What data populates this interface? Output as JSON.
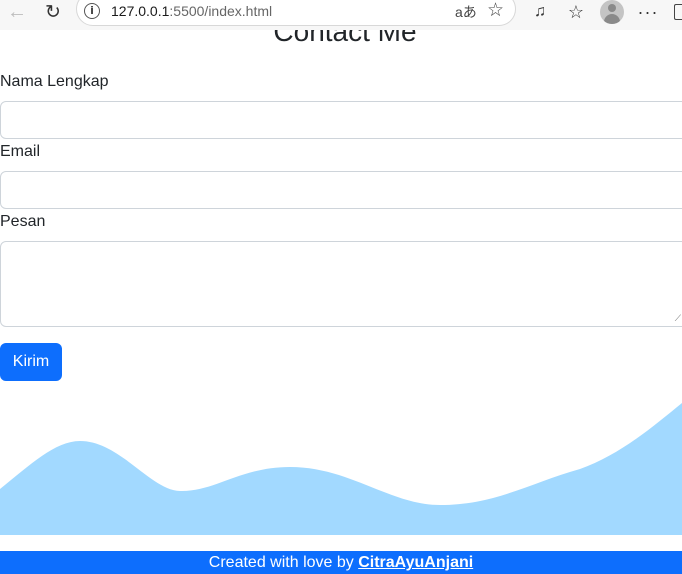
{
  "browser": {
    "url_host": "127.0.0.1",
    "url_path": ":5500/index.html",
    "read_aloud_glyph": "aあ"
  },
  "page": {
    "title": "Contact Me",
    "form": {
      "name_label": "Nama Lengkap",
      "name_value": "",
      "email_label": "Email",
      "email_value": "",
      "message_label": "Pesan",
      "message_value": "",
      "submit_label": "Kirim"
    }
  },
  "footer": {
    "prefix": "Created with love by ",
    "author": "CitraAyuAnjani"
  },
  "colors": {
    "primary": "#0d6efd",
    "wave": "#a2d9ff",
    "toolbar_bg": "#f7f7f7"
  },
  "icons": [
    "back-arrow-icon",
    "refresh-icon",
    "info-icon",
    "read-aloud-icon",
    "favorite-star-icon",
    "music-icon",
    "favorites-list-icon",
    "profile-avatar",
    "more-menu-icon",
    "sidebar-icon"
  ]
}
